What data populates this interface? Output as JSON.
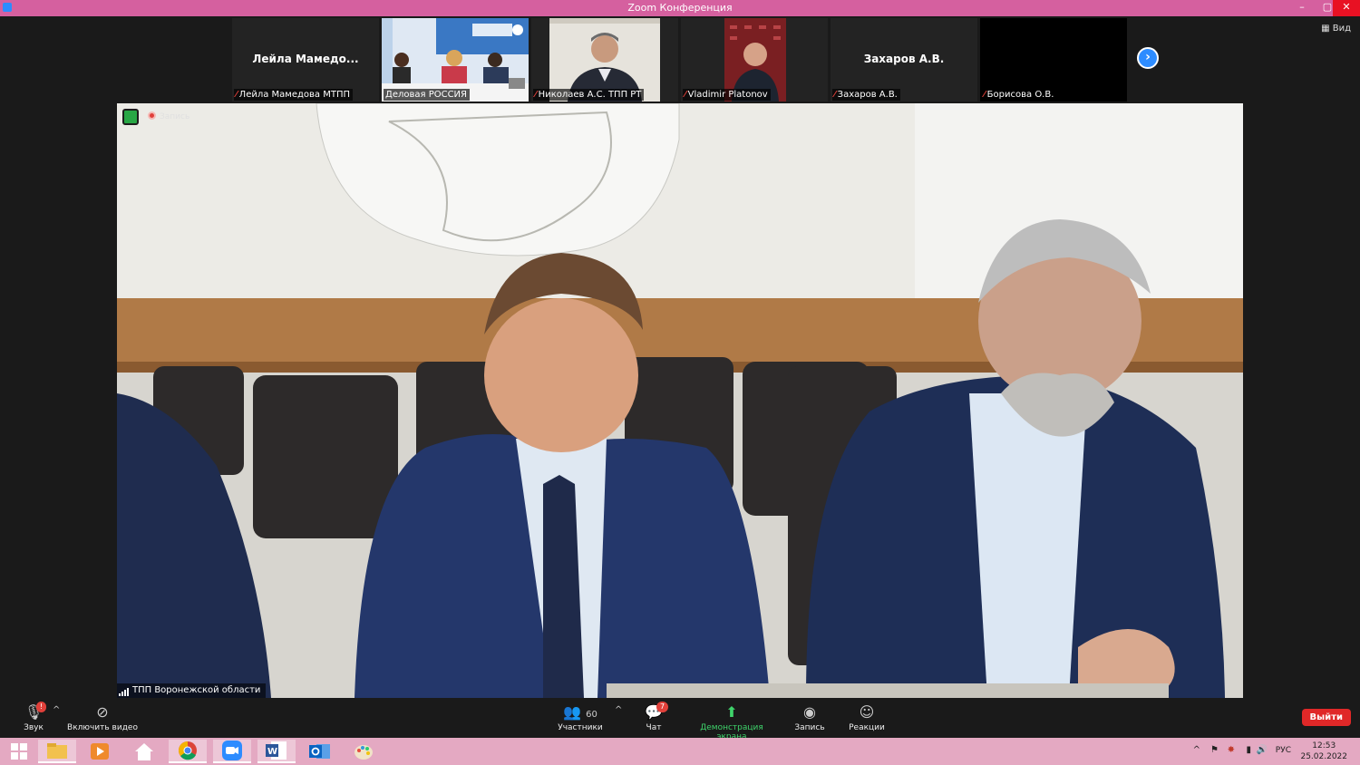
{
  "window": {
    "title": "Zoom Конференция",
    "min": "–",
    "restore": "▢",
    "close": "✕"
  },
  "view_label": "Вид",
  "participants": [
    {
      "name": "Лейла Мамедова МТПП",
      "center_name": "Лейла  Мамедо...",
      "muted": true,
      "video": false
    },
    {
      "name": "Деловая РОССИЯ",
      "center_name": "",
      "muted": false,
      "video": true
    },
    {
      "name": "Николаев А.С. ТПП РТ",
      "center_name": "",
      "muted": true,
      "video": true
    },
    {
      "name": "Vladimir Platonov",
      "center_name": "",
      "muted": true,
      "video": true
    },
    {
      "name": "Захаров А.В.",
      "center_name": "Захаров А.В.",
      "muted": true,
      "video": false
    },
    {
      "name": "Борисова О.В.",
      "center_name": "",
      "muted": true,
      "video": false
    }
  ],
  "main_video": {
    "speaker": "ТПП Воронежской области",
    "recording_label": "Запись"
  },
  "toolbar": {
    "audio_label": "Звук",
    "video_label": "Включить видео",
    "participants_label": "Участники",
    "participants_count": "60",
    "chat_label": "Чат",
    "chat_badge": "7",
    "share_label": "Демонстрация экрана",
    "record_label": "Запись",
    "reactions_label": "Реакции",
    "leave_label": "Выйти"
  },
  "taskbar": {
    "lang": "РУС",
    "time": "12:53",
    "date": "25.02.2022"
  },
  "colors": {
    "titlebar": "#d5609f",
    "taskbar": "#e4a9c2",
    "zoom_blue": "#2d8cff",
    "share_green": "#3fd46b",
    "leave_red": "#e02828"
  }
}
